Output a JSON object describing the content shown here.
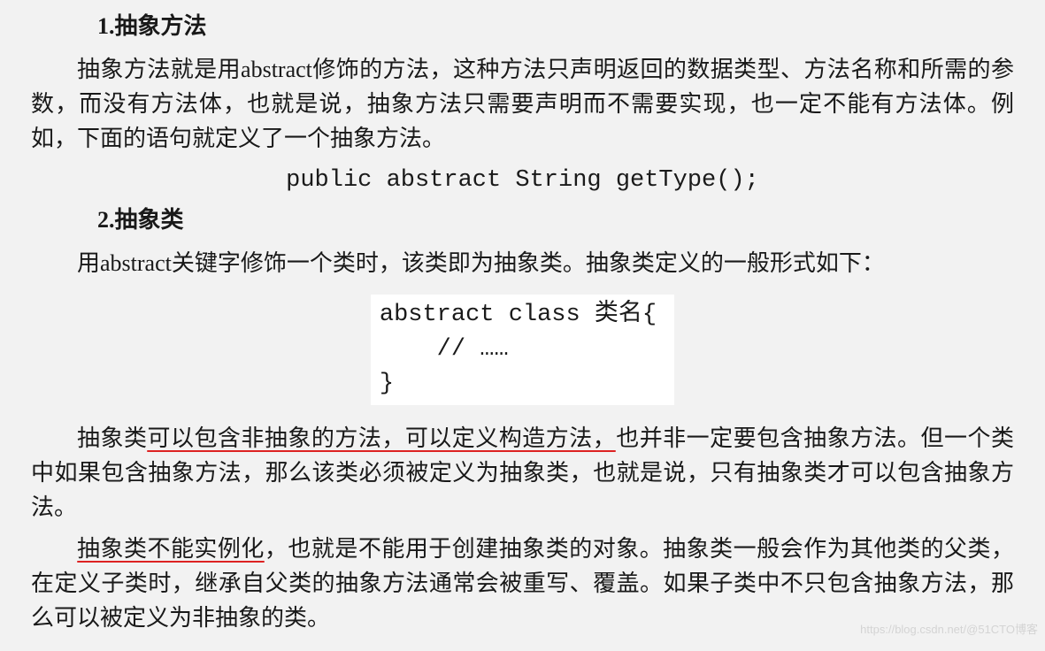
{
  "section1": {
    "heading": "1.抽象方法",
    "paragraph": "抽象方法就是用abstract修饰的方法，这种方法只声明返回的数据类型、方法名称和所需的参数，而没有方法体，也就是说，抽象方法只需要声明而不需要实现，也一定不能有方法体。例如，下面的语句就定义了一个抽象方法。",
    "code": "public abstract String getType();"
  },
  "section2": {
    "heading": "2.抽象类",
    "paragraph1": "用abstract关键字修饰一个类时，该类即为抽象类。抽象类定义的一般形式如下：",
    "code": "abstract class 类名{\n    // ……\n}",
    "paragraph2_pre": "抽象类",
    "paragraph2_underline": "可以包含非抽象的方法，可以定义构造方法，",
    "paragraph2_post": "也并非一定要包含抽象方法。但一个类中如果包含抽象方法，那么该类必须被定义为抽象类，也就是说，只有抽象类才可以包含抽象方法。",
    "paragraph3_underline": "抽象类不能实例化",
    "paragraph3_post": "，也就是不能用于创建抽象类的对象。抽象类一般会作为其他类的父类，在定义子类时，继承自父类的抽象方法通常会被重写、覆盖。如果子类中不只包含抽象方法，那么可以被定义为非抽象的类。"
  },
  "watermark": "https://blog.csdn.net/@51CTO博客"
}
